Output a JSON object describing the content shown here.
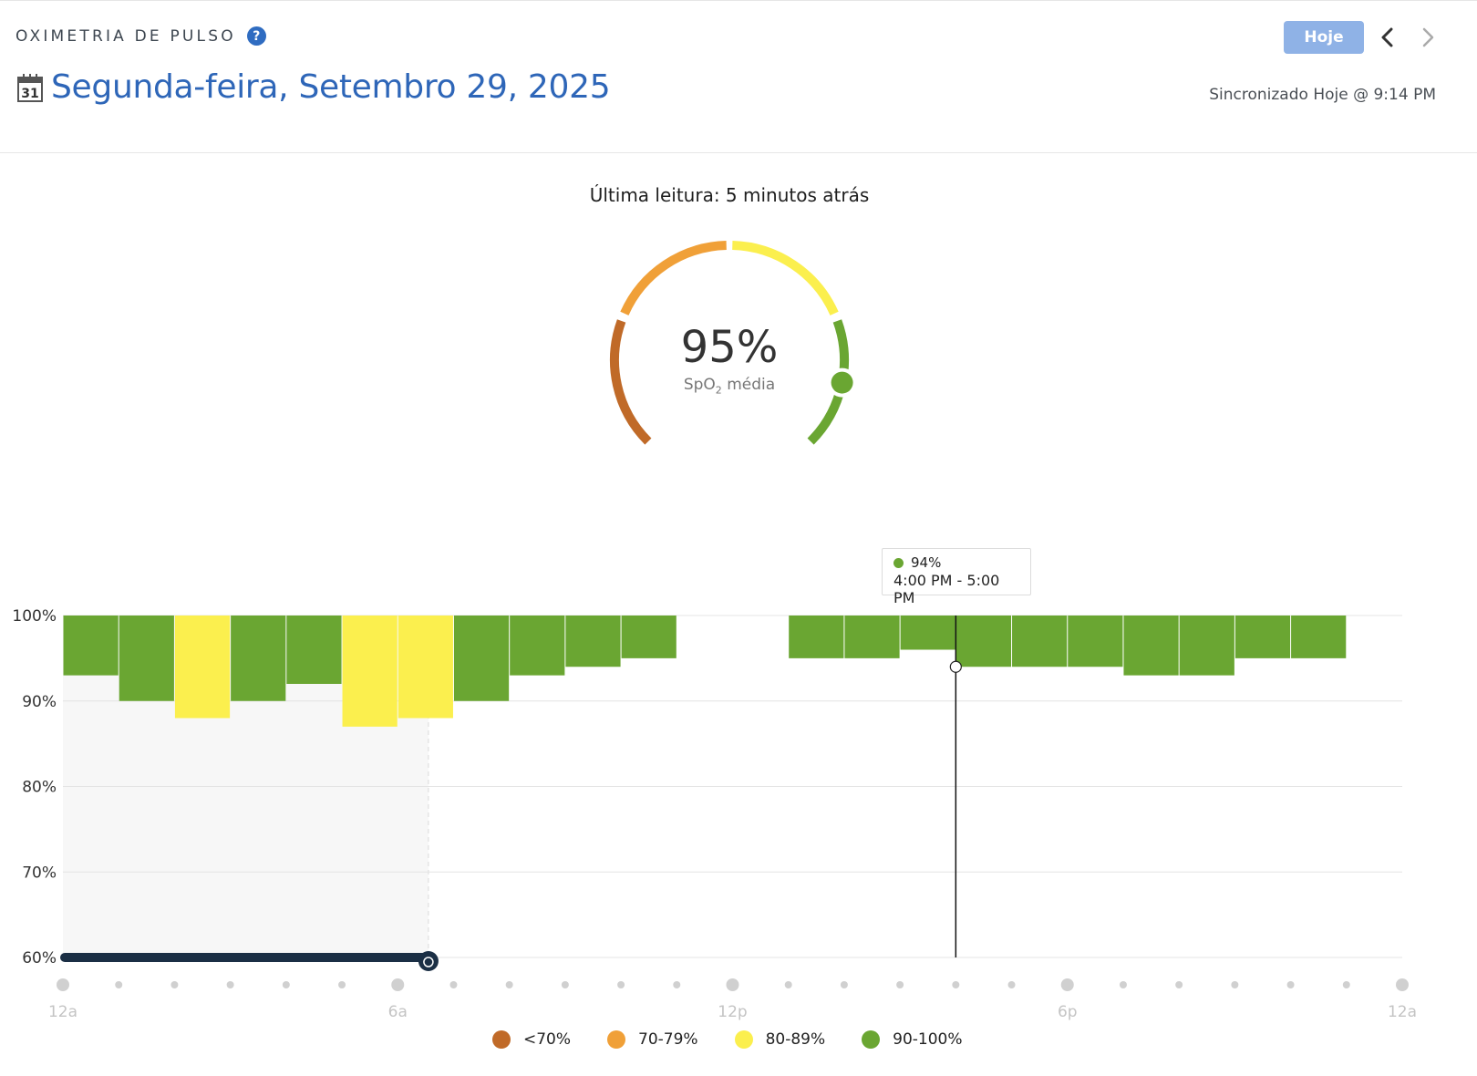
{
  "header": {
    "section_title": "OXIMETRIA DE PULSO",
    "help_icon": "?",
    "calendar_day": "31",
    "date": "Segunda-feira, Setembro 29, 2025",
    "today_button": "Hoje",
    "sync_text": "Sincronizado Hoje @ 9:14 PM"
  },
  "summary": {
    "last_reading": "Última leitura: 5 minutos atrás",
    "average_value": "95%",
    "average_label_prefix": "SpO",
    "average_label_sub": "2",
    "average_label_suffix": " média",
    "average_spo2": 95
  },
  "tooltip": {
    "value": "94%",
    "range": "4:00 PM - 5:00 PM",
    "color": "#6aa632"
  },
  "colors": {
    "lt70": "#c06a28",
    "70_79": "#f0a038",
    "80_89": "#fbef4e",
    "90_100": "#6aa632",
    "sleep_bar": "#1b2f45",
    "link_blue": "#2e66b8"
  },
  "chart_data": {
    "type": "bar",
    "ylim": [
      60,
      100
    ],
    "y_ticks": [
      "100%",
      "90%",
      "80%",
      "70%",
      "60%"
    ],
    "y_tick_values": [
      100,
      90,
      80,
      70,
      60
    ],
    "x_tick_labels": [
      "12a",
      "6a",
      "12p",
      "6p",
      "12a"
    ],
    "x_tick_hours": [
      0,
      6,
      12,
      18,
      24
    ],
    "hours": [
      0,
      1,
      2,
      3,
      4,
      5,
      6,
      7,
      8,
      9,
      10,
      13,
      14,
      15,
      16,
      17,
      18,
      19,
      20,
      21,
      22
    ],
    "values": [
      93,
      90,
      88,
      90,
      92,
      87,
      88,
      90,
      93,
      94,
      95,
      95,
      95,
      96,
      94,
      94,
      94,
      93,
      93,
      95,
      95
    ],
    "sleep_period_hours": [
      0,
      6.55
    ],
    "cursor_hour": 16,
    "cursor_value": 94
  },
  "legend": [
    {
      "label": "<70%",
      "color": "#c06a28"
    },
    {
      "label": "70-79%",
      "color": "#f0a038"
    },
    {
      "label": "80-89%",
      "color": "#fbef4e"
    },
    {
      "label": "90-100%",
      "color": "#6aa632"
    }
  ]
}
